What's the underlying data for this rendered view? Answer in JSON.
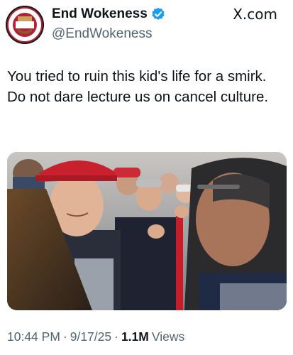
{
  "post": {
    "author": {
      "display_name": "End Wokeness",
      "handle": "@EndWokeness",
      "verified": true,
      "avatar_text": "SUPPORT THE FORMER TRUMP"
    },
    "watermark": "X.com",
    "text": "You tried to ruin this kid's life for a smirk. Do not dare lecture us on cancel culture.",
    "media": {
      "type": "photo",
      "icon": "photo-image"
    },
    "meta": {
      "time": "10:44 PM",
      "separator": "·",
      "date": "9/17/25",
      "views_count": "1.1M",
      "views_label": "Views"
    }
  },
  "colors": {
    "verified_badge": "#1d9bf0",
    "secondary_text": "#536471",
    "primary_text": "#0f1419"
  }
}
